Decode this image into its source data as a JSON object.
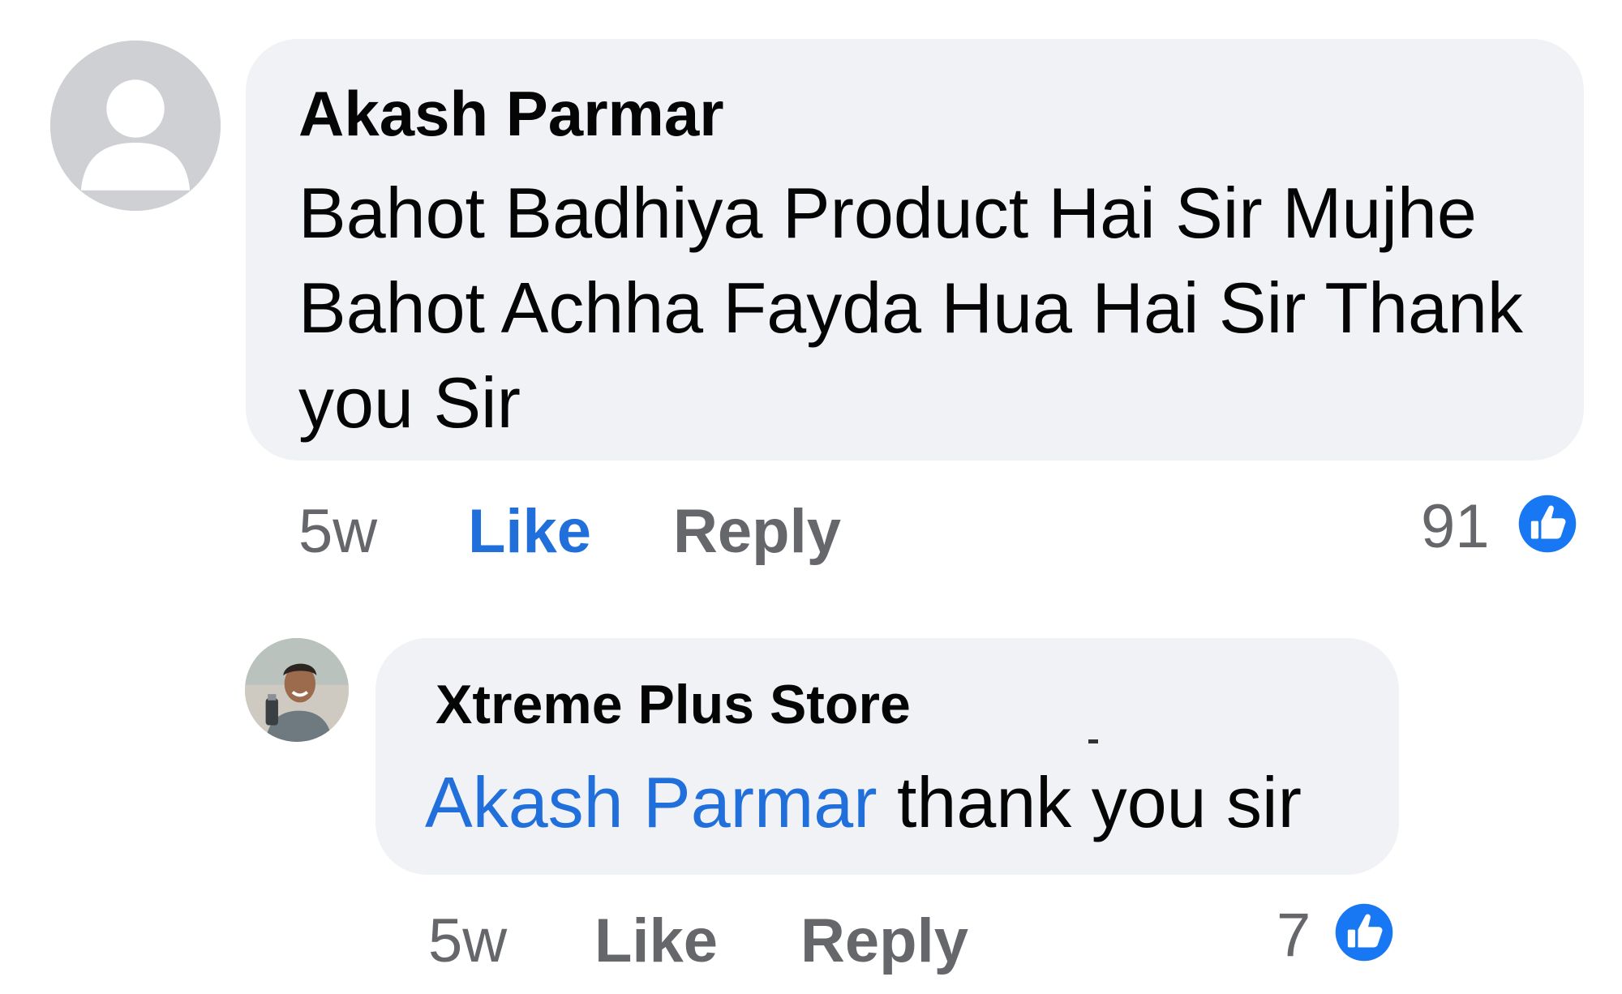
{
  "comments": [
    {
      "author": "Akash Parmar",
      "text": "Bahot Badhiya Product Hai Sir Mujhe Bahot Achha Fayda Hua Hai Sir Thank you Sir",
      "time": "5w",
      "like_label": "Like",
      "reply_label": "Reply",
      "reaction_count": "91",
      "avatar_icon": "default-profile-icon",
      "reaction_icon": "like-reaction-icon",
      "liked": true
    }
  ],
  "replies": [
    {
      "author": "Xtreme Plus Store",
      "mention": "Akash Parmar",
      "text": " thank you sir",
      "time": "5w",
      "like_label": "Like",
      "reply_label": "Reply",
      "reaction_count": "7",
      "avatar_icon": "store-profile-photo",
      "reaction_icon": "like-reaction-icon",
      "liked": false
    }
  ],
  "colors": {
    "bubble": "#f0f2f5",
    "link_blue": "#216fdb",
    "meta_gray": "#65676b",
    "text": "#050505",
    "like_icon": "#1877f2"
  }
}
